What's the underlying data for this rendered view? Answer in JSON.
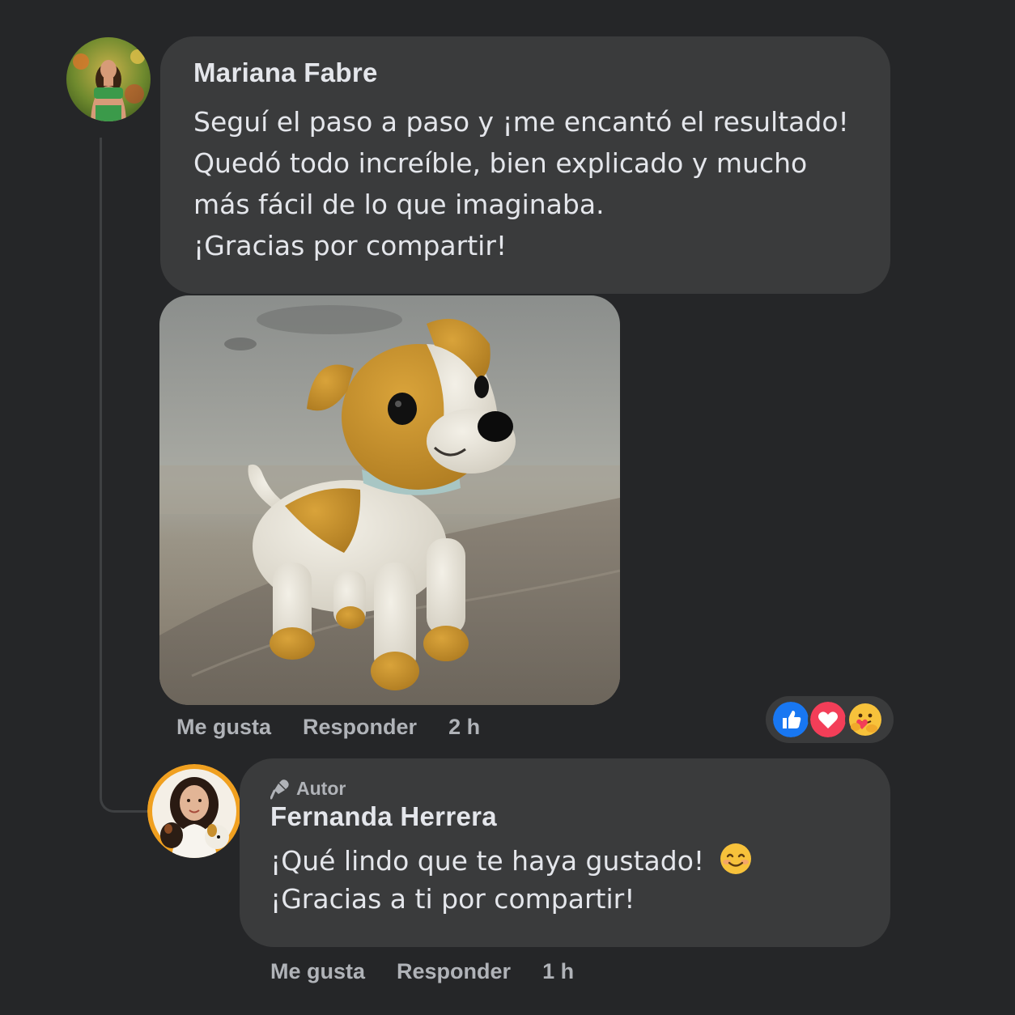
{
  "comment": {
    "author": "Mariana Fabre",
    "text_lines": [
      "Seguí el paso a paso y ¡me encantó el resultado!",
      "Quedó todo increíble, bien explicado y mucho",
      "más fácil de lo que imaginaba.",
      "¡Gracias por compartir!"
    ],
    "actions": {
      "like": "Me gusta",
      "reply": "Responder",
      "time": "2 h"
    },
    "reactions": [
      "like-icon",
      "love-icon",
      "care-icon"
    ]
  },
  "reply": {
    "badge": "Autor",
    "author": "Fernanda Herrera",
    "text_lines": [
      "¡Qué lindo que te haya gustado!",
      "¡Gracias a ti por compartir!"
    ],
    "actions": {
      "like": "Me gusta",
      "reply": "Responder",
      "time": "1 h"
    }
  },
  "colors": {
    "background": "#252628",
    "bubble": "#3a3b3c",
    "text": "#e4e6eb",
    "secondary_text": "#b0b3b8",
    "like_blue": "#1877f2",
    "love_red": "#f33e58"
  }
}
